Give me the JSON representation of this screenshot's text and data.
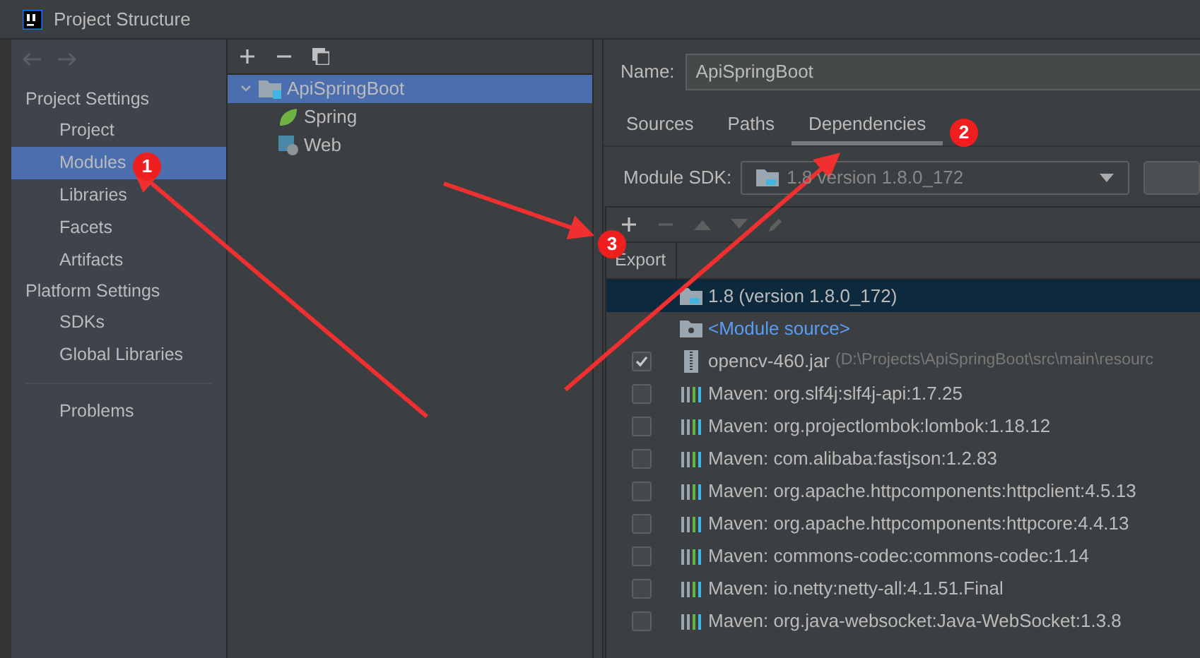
{
  "window": {
    "title": "Project Structure"
  },
  "sidebar": {
    "sections": [
      {
        "title": "Project Settings",
        "items": [
          {
            "label": "Project",
            "selected": false
          },
          {
            "label": "Modules",
            "selected": true
          },
          {
            "label": "Libraries",
            "selected": false
          },
          {
            "label": "Facets",
            "selected": false
          },
          {
            "label": "Artifacts",
            "selected": false
          }
        ]
      },
      {
        "title": "Platform Settings",
        "items": [
          {
            "label": "SDKs",
            "selected": false
          },
          {
            "label": "Global Libraries",
            "selected": false
          }
        ]
      }
    ],
    "bottom_items": [
      {
        "label": "Problems",
        "selected": false
      }
    ]
  },
  "module_tree": [
    {
      "label": "ApiSpringBoot",
      "kind": "module",
      "selected": true,
      "expanded": true,
      "children": [
        {
          "label": "Spring",
          "kind": "spring",
          "selected": false
        },
        {
          "label": "Web",
          "kind": "web",
          "selected": false
        }
      ]
    }
  ],
  "name_field": {
    "label": "Name:",
    "value": "ApiSpringBoot"
  },
  "tabs": [
    {
      "label": "Sources",
      "selected": false
    },
    {
      "label": "Paths",
      "selected": false
    },
    {
      "label": "Dependencies",
      "selected": true
    }
  ],
  "module_sdk": {
    "label": "Module SDK:",
    "value": "1.8 version 1.8.0_172"
  },
  "table": {
    "columns": [
      "Export"
    ],
    "rows": [
      {
        "kind": "sdk",
        "label": "1.8 (version 1.8.0_172)",
        "selected": true
      },
      {
        "kind": "module-source",
        "label": "<Module source>",
        "selected": false
      },
      {
        "kind": "jar",
        "label": "opencv-460.jar",
        "path": "(D:\\Projects\\ApiSpringBoot\\src\\main\\resourc",
        "checked": true,
        "selected": false
      },
      {
        "kind": "maven",
        "label": "Maven: org.slf4j:slf4j-api:1.7.25",
        "checked": false,
        "selected": false
      },
      {
        "kind": "maven",
        "label": "Maven: org.projectlombok:lombok:1.18.12",
        "checked": false,
        "selected": false
      },
      {
        "kind": "maven",
        "label": "Maven: com.alibaba:fastjson:1.2.83",
        "checked": false,
        "selected": false
      },
      {
        "kind": "maven",
        "label": "Maven: org.apache.httpcomponents:httpclient:4.5.13",
        "checked": false,
        "selected": false
      },
      {
        "kind": "maven",
        "label": "Maven: org.apache.httpcomponents:httpcore:4.4.13",
        "checked": false,
        "selected": false
      },
      {
        "kind": "maven",
        "label": "Maven: commons-codec:commons-codec:1.14",
        "checked": false,
        "selected": false
      },
      {
        "kind": "maven",
        "label": "Maven: io.netty:netty-all:4.1.51.Final",
        "checked": false,
        "selected": false
      },
      {
        "kind": "maven",
        "label": "Maven: org.java-websocket:Java-WebSocket:1.3.8",
        "checked": false,
        "selected": false
      }
    ]
  },
  "annotations": [
    "1",
    "2",
    "3"
  ]
}
